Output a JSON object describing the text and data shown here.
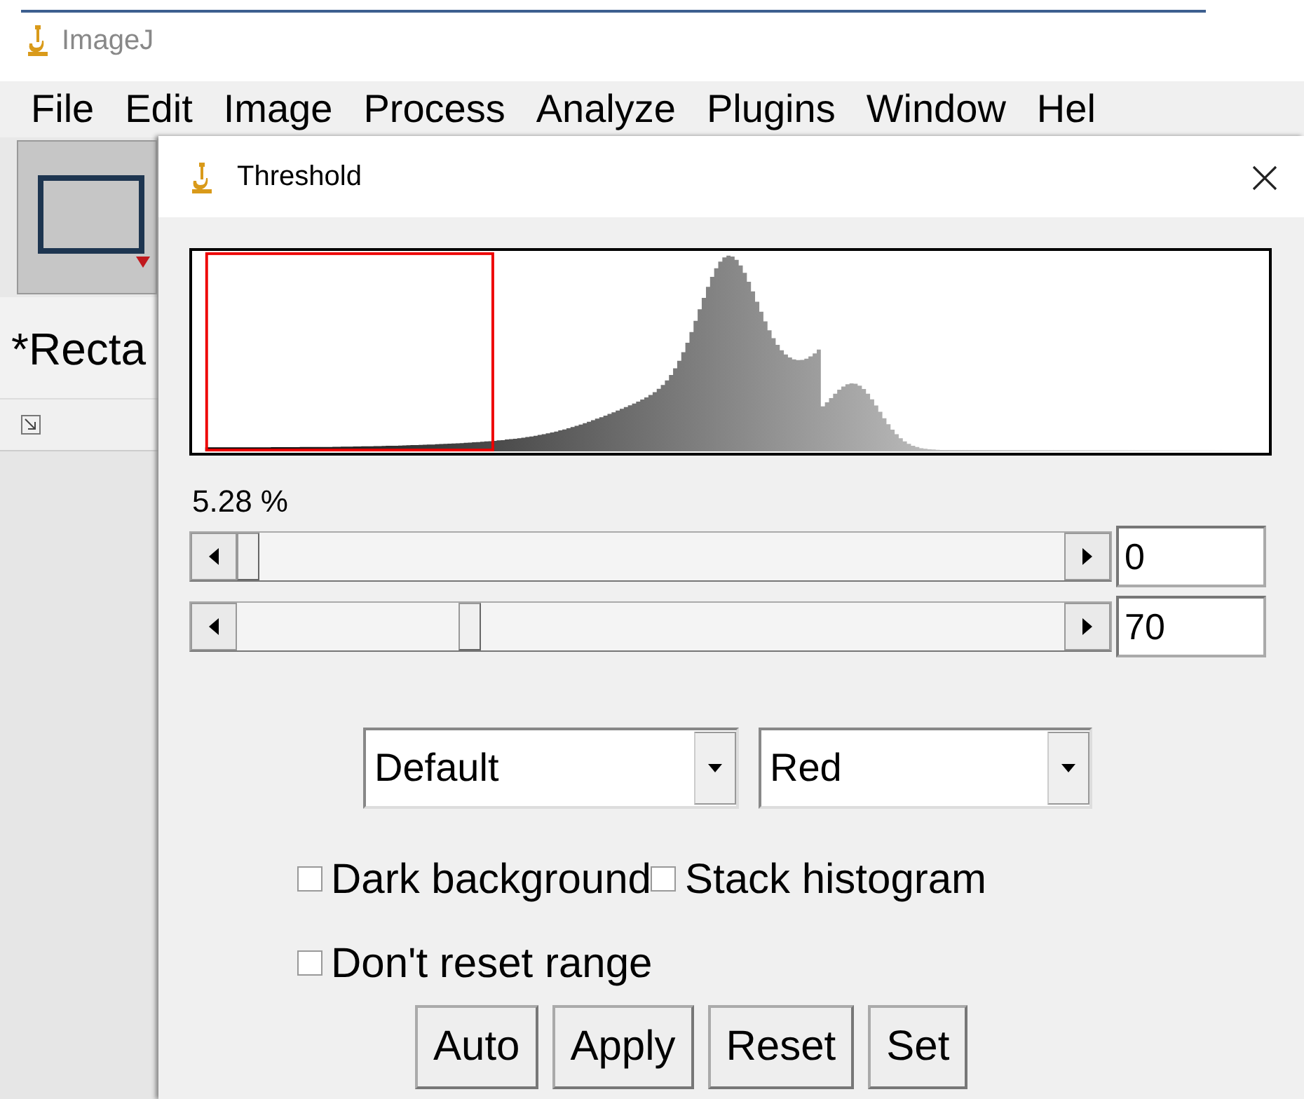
{
  "app": {
    "title": "ImageJ",
    "menu": [
      "File",
      "Edit",
      "Image",
      "Process",
      "Analyze",
      "Plugins",
      "Window",
      "Hel"
    ],
    "tool": {
      "selected": true
    },
    "status_text": "*Recta"
  },
  "dialog": {
    "title": "Threshold",
    "histogram": {
      "kind": "picture"
    },
    "percent": "5.28 %",
    "sliders": [
      {
        "value": "0"
      },
      {
        "value": "70"
      }
    ],
    "dropdowns": [
      {
        "value": "Default"
      },
      {
        "value": "Red"
      }
    ],
    "checkbox_rows": [
      [
        {
          "label": "Dark background",
          "checked": false
        },
        {
          "label": "Stack histogram",
          "checked": false
        }
      ],
      [
        {
          "label": "Don't reset range",
          "checked": false
        }
      ]
    ],
    "buttons": [
      "Auto",
      "Apply",
      "Reset",
      "Set"
    ]
  }
}
